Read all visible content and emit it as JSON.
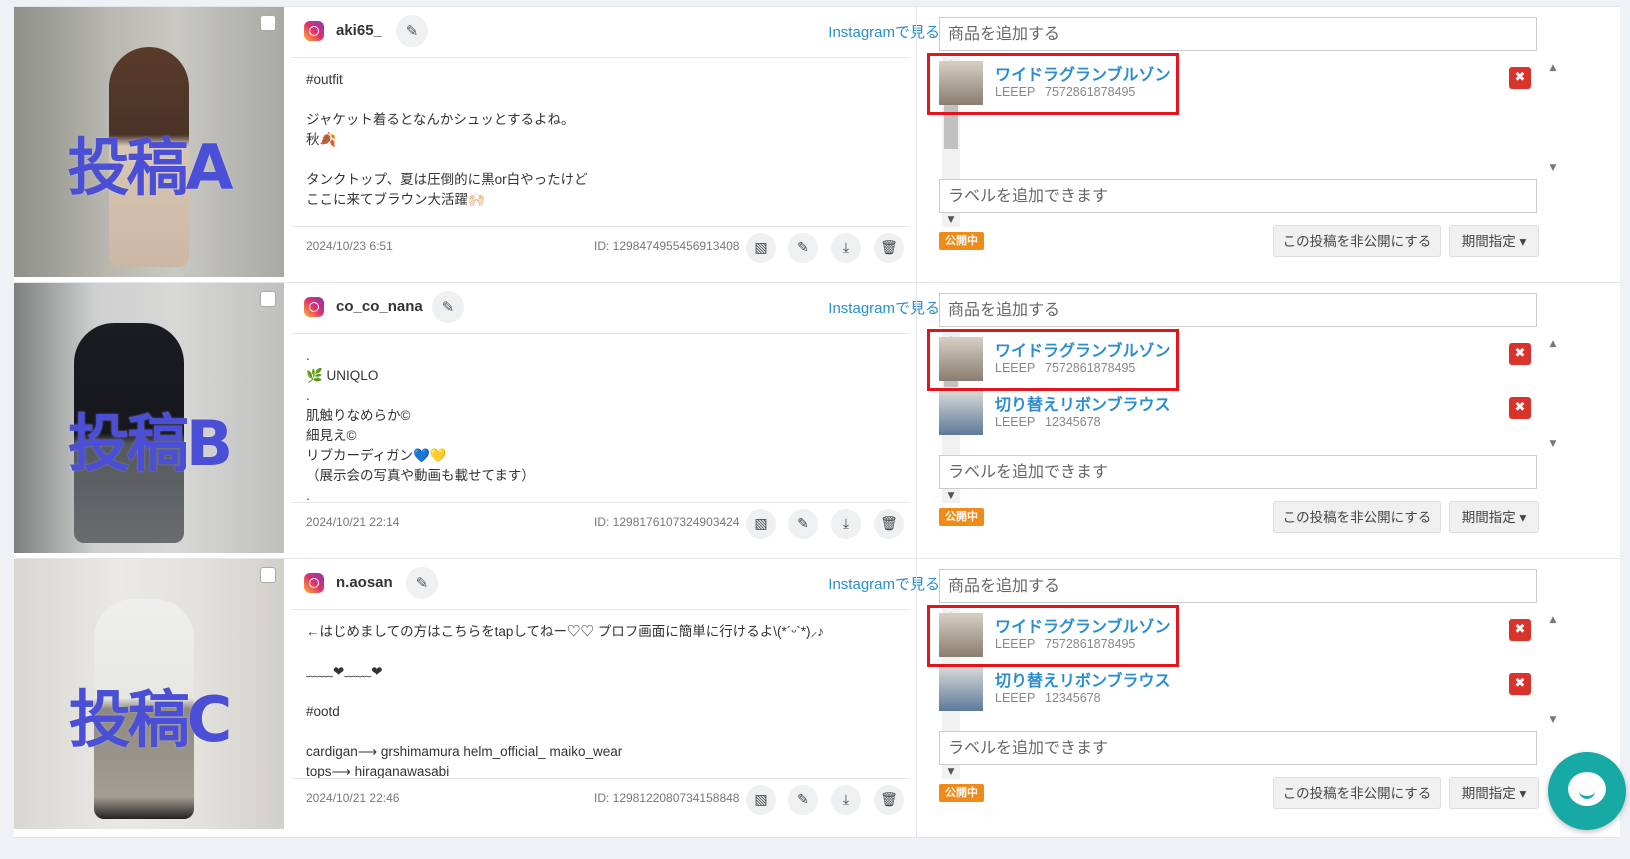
{
  "common": {
    "instagram_link": "Instagramで見る",
    "add_product_placeholder": "商品を追加する",
    "label_placeholder": "ラベルを追加できます",
    "status_badge": "公開中",
    "hide_post_button": "この投稿を非公開にする",
    "period_button": "期間指定",
    "brand": "LEEEP",
    "pencil_glyph": "✎",
    "delete_glyph": "✖",
    "image_glyph": "▧",
    "download_glyph": "⤓",
    "trash_glyph": "🗑",
    "caret_glyph": "▾",
    "colors": {
      "link": "#2a8dd0",
      "delete": "#d9342b",
      "status": "#f08a18",
      "overlay_text": "#4a4fd6",
      "highlight": "#e3141b",
      "chat": "#17a9a4"
    }
  },
  "posts": [
    {
      "overlay": "投稿A",
      "username": "aki65_",
      "caption": [
        "#outfit",
        "",
        "ジャケット着るとなんかシュッとするよね。",
        "秋🍂",
        "",
        "タンクトップ、夏は圧倒的に黒or白やったけど",
        "ここに来てブラウン大活躍🙌🏻"
      ],
      "date": "2024/10/23 6:51",
      "post_id": "ID: 1298474955456913408",
      "products": [
        {
          "name": "ワイドラグランブルゾン",
          "code": "7572861878495"
        }
      ]
    },
    {
      "overlay": "投稿B",
      "username": "co_co_nana",
      "caption": [
        ".",
        "🌿 UNIQLO",
        ".",
        "肌触りなめらか©",
        "細見え©",
        "リブカーディガン💙💛",
        "（展示会の写真や動画も載せてます）",
        "."
      ],
      "date": "2024/10/21 22:14",
      "post_id": "ID: 1298176107324903424",
      "products": [
        {
          "name": "ワイドラグランブルゾン",
          "code": "7572861878495"
        },
        {
          "name": "切り替えリボンブラウス",
          "code": "12345678"
        }
      ]
    },
    {
      "overlay": "投稿C",
      "username": "n.aosan",
      "caption": [
        "←はじめましての方はこちらをtapしてねー♡♡ プロフ画面に簡単に行けるよ\\(*´ᵕ`*)⸝♪",
        "",
        "﹏﹏❤︎﹏﹏❤︎",
        "",
        "#ootd",
        "",
        "cardigan⟶ grshimamura helm_official_ maiko_wear",
        "tops⟶ hiraganawasabi"
      ],
      "date": "2024/10/21 22:46",
      "post_id": "ID: 1298122080734158848",
      "products": [
        {
          "name": "ワイドラグランブルゾン",
          "code": "7572861878495"
        },
        {
          "name": "切り替えリボンブラウス",
          "code": "12345678"
        }
      ]
    }
  ]
}
